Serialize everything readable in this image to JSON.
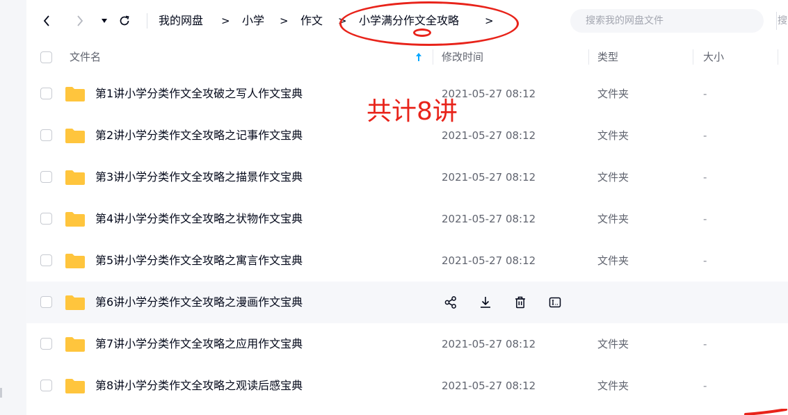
{
  "toolbar": {
    "back_label": "<",
    "forward_label": ">",
    "dropdown_icon": "caret-down",
    "refresh_icon": "refresh"
  },
  "breadcrumb": {
    "items": [
      "我的网盘",
      "小学",
      "作文",
      "小学满分作文全攻略"
    ],
    "separator": ">"
  },
  "search": {
    "placeholder": "搜索我的网盘文件",
    "second_label": "搜"
  },
  "columns": {
    "name": "文件名",
    "modified": "修改时间",
    "type": "类型",
    "size": "大小"
  },
  "files": [
    {
      "name": "第1讲小学分类作文全攻破之写人作文宝典",
      "modified": "2021-05-27 08:12",
      "type": "文件夹",
      "size": "-"
    },
    {
      "name": "第2讲小学分类作文全攻略之记事作文宝典",
      "modified": "2021-05-27 08:12",
      "type": "文件夹",
      "size": "-"
    },
    {
      "name": "第3讲小学分类作文全攻略之描景作文宝典",
      "modified": "2021-05-27 08:12",
      "type": "文件夹",
      "size": "-"
    },
    {
      "name": "第4讲小学分类作文全攻略之状物作文宝典",
      "modified": "2021-05-27 08:12",
      "type": "文件夹",
      "size": "-"
    },
    {
      "name": "第5讲小学分类作文全攻略之寓言作文宝典",
      "modified": "2021-05-27 08:12",
      "type": "文件夹",
      "size": "-"
    },
    {
      "name": "第6讲小学分类作文全攻略之漫画作文宝典",
      "hovered": true,
      "actions": [
        "share-icon",
        "download-icon",
        "delete-icon",
        "rename-icon"
      ]
    },
    {
      "name": "第7讲小学分类作文全攻略之应用作文宝典",
      "modified": "2021-05-27 08:12",
      "type": "文件夹",
      "size": "-"
    },
    {
      "name": "第8讲小学分类作文全攻略之观读后感宝典",
      "modified": "2021-05-27 08:12",
      "type": "文件夹",
      "size": "-"
    }
  ],
  "annotation": {
    "text": "共计8讲",
    "color": "#e8231a"
  },
  "colors": {
    "folder": "#ffc53d",
    "accent": "#06a7ff",
    "text": "#03081a",
    "muted": "#60646f"
  }
}
